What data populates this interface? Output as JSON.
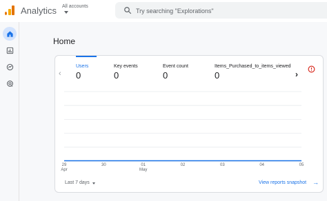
{
  "header": {
    "app_name": "Analytics",
    "account_label": "All accounts",
    "search_placeholder": "Try searching \"Explorations\""
  },
  "nav_rail": {
    "items": [
      {
        "icon": "home-icon",
        "active": true
      },
      {
        "icon": "reports-icon",
        "active": false
      },
      {
        "icon": "explore-icon",
        "active": false
      },
      {
        "icon": "advertising-icon",
        "active": false
      }
    ]
  },
  "page": {
    "title": "Home"
  },
  "card": {
    "metrics": [
      {
        "label": "Users",
        "value": "0",
        "active": true
      },
      {
        "label": "Key events",
        "value": "0",
        "active": false
      },
      {
        "label": "Event count",
        "value": "0",
        "active": false
      },
      {
        "label": "Items_Purchased_to_items_viewed",
        "value": "0",
        "active": false
      }
    ],
    "date_range_label": "Last 7 days",
    "view_snapshot_label": "View reports snapshot",
    "snapshot_arrow": "→",
    "prev_arrow": "‹",
    "next_arrow": "›",
    "accent_color": "#1a73e8"
  },
  "chart_data": {
    "type": "line",
    "x": [
      "29 Apr",
      "30",
      "01 May",
      "02",
      "03",
      "04",
      "05"
    ],
    "tick_labels": [
      {
        "day": "29",
        "month": "Apr"
      },
      {
        "day": "30",
        "month": ""
      },
      {
        "day": "01",
        "month": "May"
      },
      {
        "day": "02",
        "month": ""
      },
      {
        "day": "03",
        "month": ""
      },
      {
        "day": "04",
        "month": ""
      },
      {
        "day": "05",
        "month": ""
      }
    ],
    "series": [
      {
        "values": [
          0,
          0,
          0,
          0,
          0,
          0,
          0
        ]
      }
    ],
    "grid": true,
    "line_color": "#1a73e8"
  }
}
